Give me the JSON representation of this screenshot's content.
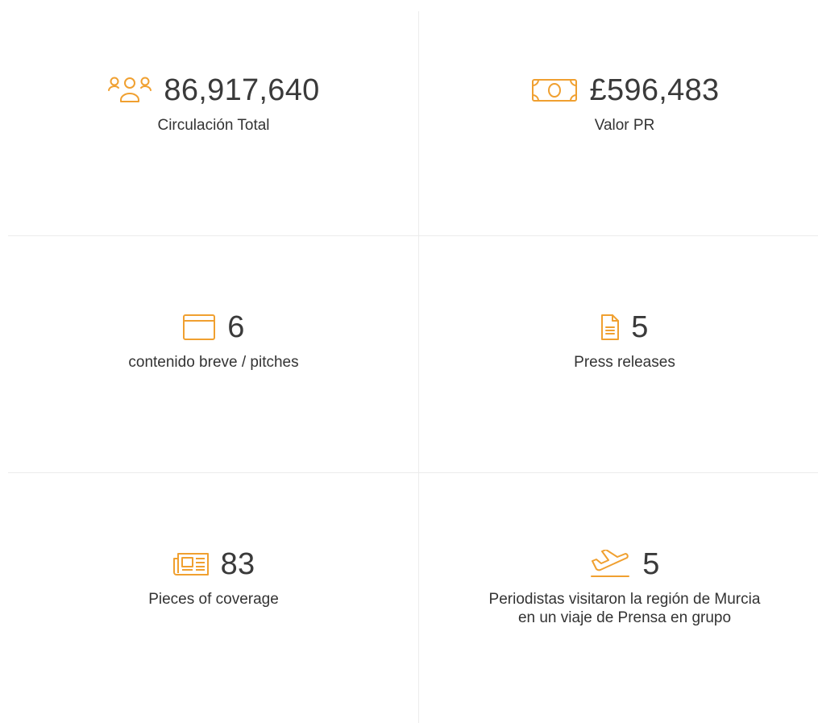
{
  "accent_color": "#f0a030",
  "stats": [
    {
      "icon": "users-icon",
      "value": "86,917,640",
      "label": "Circulación Total"
    },
    {
      "icon": "money-icon",
      "value": "£596,483",
      "label": "Valor PR"
    },
    {
      "icon": "browser-window-icon",
      "value": "6",
      "label": "contenido breve / pitches"
    },
    {
      "icon": "document-icon",
      "value": "5",
      "label": "Press releases"
    },
    {
      "icon": "newspaper-icon",
      "value": "83",
      "label": "Pieces of coverage"
    },
    {
      "icon": "plane-takeoff-icon",
      "value": "5",
      "label_line1": "Periodistas visitaron la región de Murcia",
      "label_line2": "en un viaje de Prensa en grupo"
    }
  ]
}
